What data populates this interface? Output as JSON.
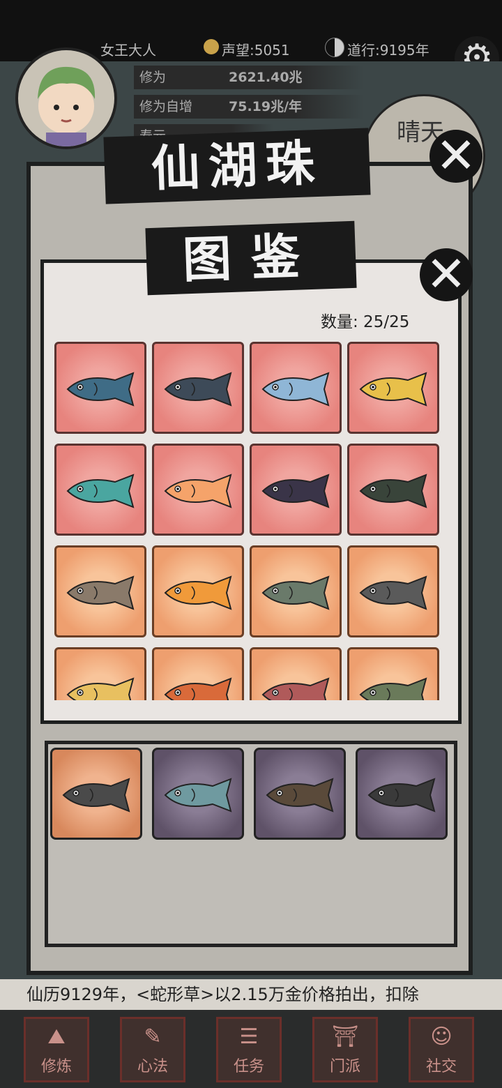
{
  "status": {
    "player_name": "女王大人",
    "reputation_label": "声望:5051",
    "dao_label": "道行:9195年"
  },
  "stats": {
    "cultivation_label": "修为",
    "cultivation_value": "2621.40兆",
    "growth_label": "修为自增",
    "growth_value": "75.19兆/年",
    "life_label": "寿元"
  },
  "weather": {
    "label": "晴天"
  },
  "dialog_outer": {
    "title": "仙湖珠"
  },
  "dialog_inner": {
    "title": "图鉴",
    "count_text": "数量: 25/25"
  },
  "fish_grid": [
    {
      "rarity": "red",
      "icon": "whale-fish-icon",
      "color": "#3f6c86"
    },
    {
      "rarity": "red",
      "icon": "sea-dragon-fish-icon",
      "color": "#3d4a58"
    },
    {
      "rarity": "red",
      "icon": "blue-grouper-icon",
      "color": "#8fb6d6"
    },
    {
      "rarity": "red",
      "icon": "golden-dragon-fish-icon",
      "color": "#e8c04a"
    },
    {
      "rarity": "red",
      "icon": "antler-fish-icon",
      "color": "#4aa6a0"
    },
    {
      "rarity": "red",
      "icon": "fire-fin-fish-icon",
      "color": "#f5a36a"
    },
    {
      "rarity": "red",
      "icon": "viperfish-icon",
      "color": "#3a3448"
    },
    {
      "rarity": "red",
      "icon": "anglerfish-icon",
      "color": "#39443a"
    },
    {
      "rarity": "orange",
      "icon": "shark-icon",
      "color": "#8a7a6a"
    },
    {
      "rarity": "orange",
      "icon": "goldfish-icon",
      "color": "#f09a3a"
    },
    {
      "rarity": "orange",
      "icon": "paddlefish-icon",
      "color": "#6a7a6a"
    },
    {
      "rarity": "orange",
      "icon": "grouper-icon",
      "color": "#5a5a5a"
    },
    {
      "rarity": "orange",
      "icon": "crowned-fish-icon",
      "color": "#e8c060"
    },
    {
      "rarity": "orange",
      "icon": "lionfish-icon",
      "color": "#d96a3a"
    },
    {
      "rarity": "orange",
      "icon": "red-shark-icon",
      "color": "#b05a5a"
    },
    {
      "rarity": "orange",
      "icon": "gar-fish-icon",
      "color": "#6a7a5a"
    }
  ],
  "inventory": [
    {
      "rarity": "orange",
      "icon": "mandarin-fish-icon",
      "color": "#4a4a4a"
    },
    {
      "rarity": "purple",
      "icon": "small-fish-icon",
      "color": "#6f9aa0"
    },
    {
      "rarity": "purple",
      "icon": "eel-icon",
      "color": "#5a4a3a"
    },
    {
      "rarity": "purple",
      "icon": "narwhal-fish-icon",
      "color": "#3a3a3a"
    }
  ],
  "ticker": {
    "text": "仙历9129年，<蛇形草>以2.15万金价格拍出，扣除"
  },
  "nav": [
    {
      "label": "修炼",
      "icon": "mountain-icon"
    },
    {
      "label": "心法",
      "icon": "scroll-icon"
    },
    {
      "label": "任务",
      "icon": "task-icon"
    },
    {
      "label": "门派",
      "icon": "gate-icon"
    },
    {
      "label": "社交",
      "icon": "people-icon"
    }
  ]
}
